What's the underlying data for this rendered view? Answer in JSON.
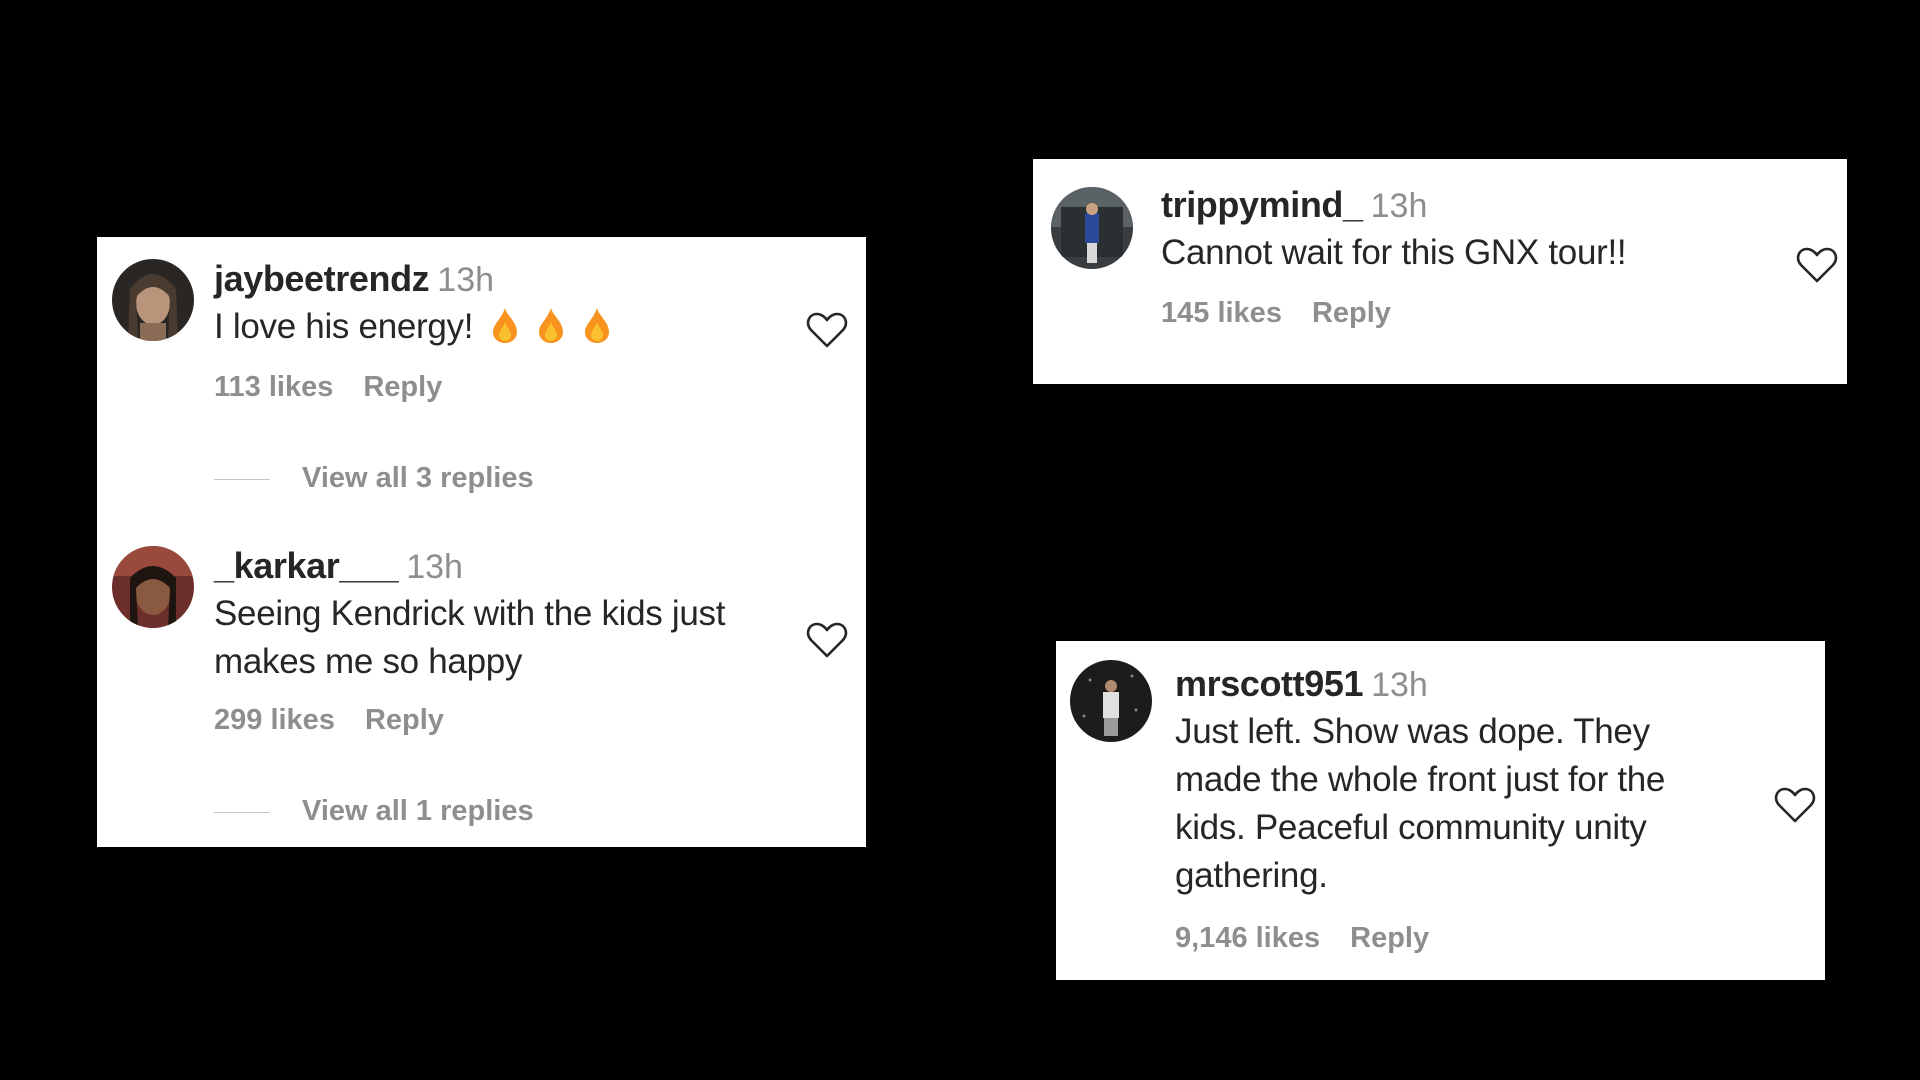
{
  "cards": {
    "card1": {
      "comments": [
        {
          "username": "jaybeetrendz",
          "time": "13h",
          "text": "I love his energy!",
          "emoji": [
            "fire-emoji",
            "fire-emoji",
            "fire-emoji"
          ],
          "likes": "113 likes",
          "reply": "Reply",
          "view_replies": "View all 3 replies"
        },
        {
          "username": "_karkar___",
          "time": "13h",
          "text_lines": [
            "Seeing Kendrick with the kids just",
            "makes me so happy"
          ],
          "likes": "299 likes",
          "reply": "Reply",
          "view_replies": "View all 1 replies"
        }
      ]
    },
    "card2": {
      "comment": {
        "username": "trippymind_",
        "time": "13h",
        "text": "Cannot wait for this GNX tour!!",
        "likes": "145 likes",
        "reply": "Reply"
      }
    },
    "card3": {
      "comment": {
        "username": "mrscott951",
        "time": "13h",
        "text_lines": [
          "Just left. Show was dope. They",
          "made the whole front just for the",
          "kids. Peaceful community unity",
          "gathering."
        ],
        "likes": "9,146 likes",
        "reply": "Reply"
      }
    }
  },
  "colors": {
    "background": "#000000",
    "card": "#ffffff",
    "primary_text": "#262626",
    "secondary_text": "#8e8e8e",
    "fire": "#f7931e"
  },
  "icons": [
    "heart-outline-icon",
    "fire-emoji",
    "avatar"
  ]
}
